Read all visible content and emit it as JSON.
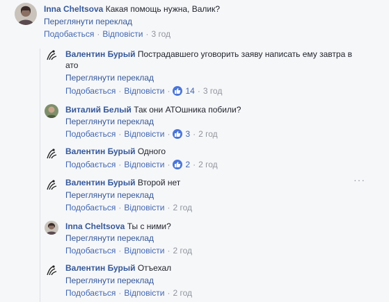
{
  "common": {
    "translate": "Переглянути переклад",
    "like": "Подобається",
    "reply": "Відповісти"
  },
  "top": {
    "name": "Inna Cheltsova",
    "text": "Какая помощь нужна, Валик?",
    "time": "3 год"
  },
  "replies": [
    {
      "name": "Валентин Бурый",
      "text": "Пострадавшего уговорить заяву написать ему завтра в ато",
      "likes": "14",
      "time": "3 год"
    },
    {
      "name": "Виталий Белый",
      "text": "Так они АТОшника побили?",
      "likes": "3",
      "time": "2 год"
    },
    {
      "name": "Валентин Бурый",
      "text": "Одного",
      "likes": "2",
      "time": "2 год"
    },
    {
      "name": "Валентин Бурый",
      "text": "Второй нет",
      "time": "2 год"
    },
    {
      "name": "Inna Cheltsova",
      "text": "Ты с ними?",
      "time": "2 год"
    },
    {
      "name": "Валентин Бурый",
      "text": "Отъехал",
      "time": "2 год"
    }
  ],
  "colors": {
    "name": "#365899",
    "link": "#4267b2",
    "meta": "#90949c",
    "like_badge": "#4a76d8",
    "background": "#f6f7f9"
  }
}
